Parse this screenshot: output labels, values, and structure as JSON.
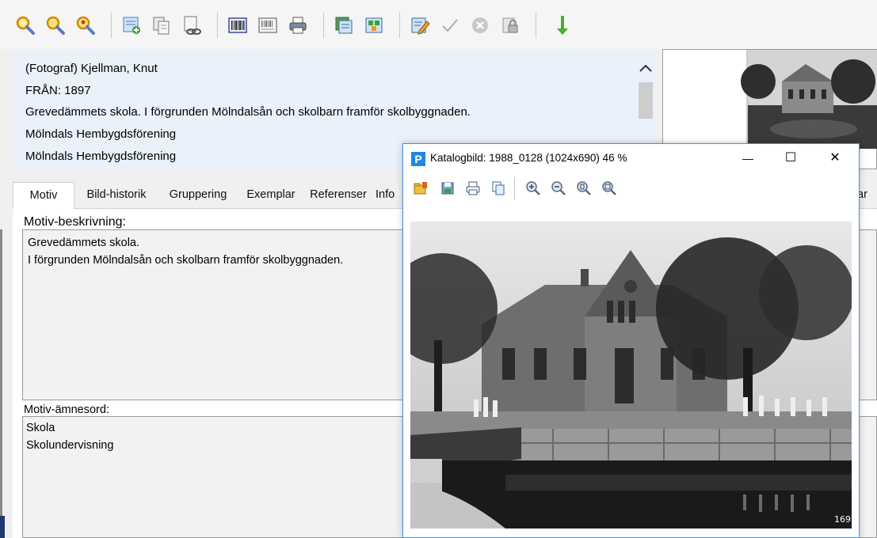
{
  "toolbar": {
    "icons": [
      "search-icon",
      "search-plus-icon",
      "search-user-icon",
      "new-record-icon",
      "copy-record-icon",
      "link-record-icon",
      "barcode-icon",
      "barcode-list-icon",
      "print-icon",
      "cards-icon",
      "export-icon",
      "edit-icon",
      "approve-icon",
      "cancel-icon",
      "lock-icon",
      "arrow-down-icon"
    ]
  },
  "info": {
    "photographer": "(Fotograf)  Kjellman, Knut",
    "year": "FRÅN:  1897",
    "description": "Grevedämmets skola. I förgrunden Mölndalsån och skolbarn framför skolbyggnaden.",
    "owner1": "Mölndals Hembygdsförening",
    "owner2": "Mölndals Hembygdsförening"
  },
  "tabs": [
    {
      "label": "Motiv",
      "active": true
    },
    {
      "label": "Bild-historik"
    },
    {
      "label": "Gruppering"
    },
    {
      "label": "Exemplar"
    },
    {
      "label": "Referenser"
    },
    {
      "label": "Info"
    }
  ],
  "tab_right_fragment": "ar",
  "motiv": {
    "description_label": "Motiv-beskrivning:",
    "description_lines": [
      "Grevedämmets skola.",
      "I förgrunden Mölndalsån och skolbarn framför skolbyggnaden."
    ],
    "keywords_label": "Motiv-ämnesord:",
    "keywords": [
      "Skola",
      "Skolundervisning"
    ]
  },
  "viewer": {
    "title": "Katalogbild: 1988_0128 (1024x690) 46 %",
    "app_icon_letter": "P",
    "minimize": "—",
    "maximize": "☐",
    "close": "✕",
    "photo_number": "169"
  },
  "colors": {
    "info_bg": "#e9f1fb",
    "window_border": "#4a90d9",
    "app_icon": "#1e88e5"
  }
}
